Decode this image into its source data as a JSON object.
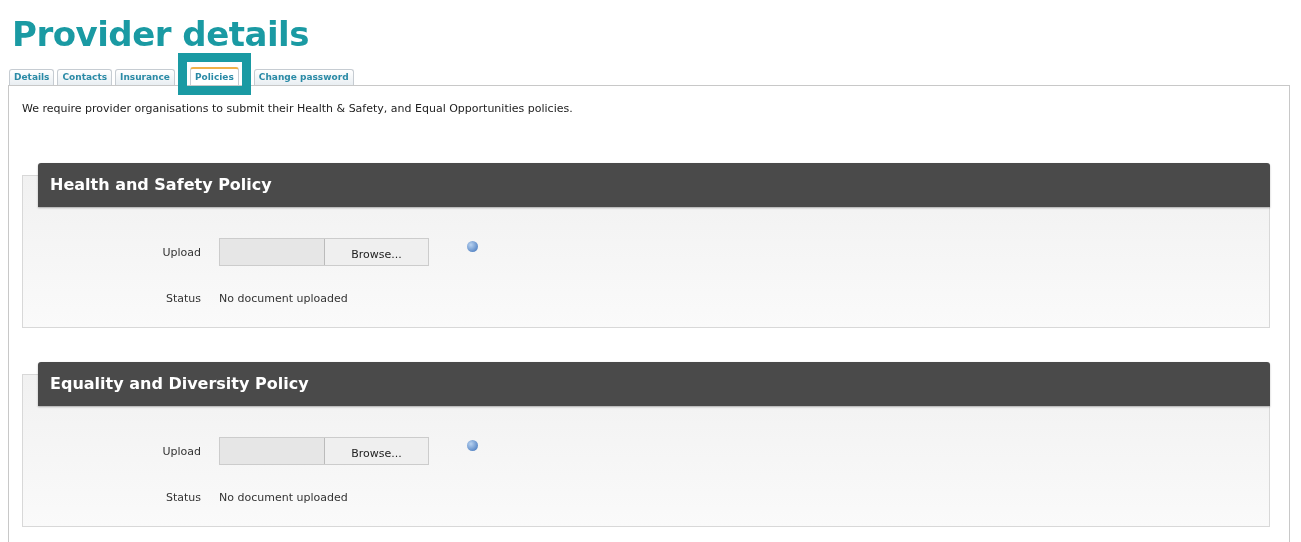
{
  "page_title": "Provider details",
  "tabs": [
    {
      "label": "Details",
      "selected": false
    },
    {
      "label": "Contacts",
      "selected": false
    },
    {
      "label": "Insurance",
      "selected": false
    },
    {
      "label": "Policies",
      "selected": true
    },
    {
      "label": "Change password",
      "selected": false
    }
  ],
  "intro": "We require provider organisations to submit their Health & Safety, and Equal Opportunities policies.",
  "policies": [
    {
      "title": "Health and Safety Policy",
      "upload_label": "Upload",
      "browse_button": "Browse...",
      "status_label": "Status",
      "status": "No document uploaded"
    },
    {
      "title": "Equality and Diversity Policy",
      "upload_label": "Upload",
      "browse_button": "Browse...",
      "status_label": "Status",
      "status": "No document uploaded"
    }
  ]
}
